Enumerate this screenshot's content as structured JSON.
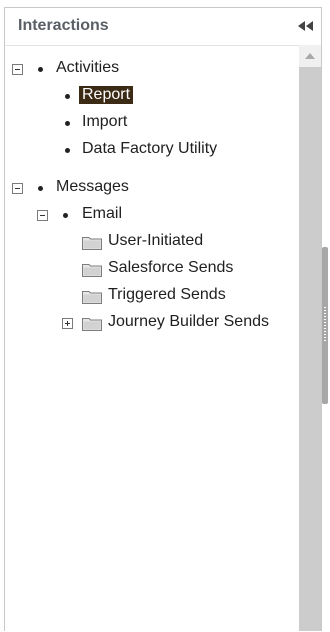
{
  "panel": {
    "title": "Interactions"
  },
  "tree": {
    "activities": {
      "label": "Activities",
      "items": [
        "Report",
        "Import",
        "Data Factory Utility"
      ]
    },
    "messages": {
      "label": "Messages",
      "email": {
        "label": "Email",
        "folders": [
          "User-Initiated",
          "Salesforce Sends",
          "Triggered Sends",
          "Journey Builder Sends"
        ]
      }
    },
    "selected": "Report"
  },
  "icons": {
    "collapse": "double-chevron-left-icon",
    "folder": "folder-icon",
    "expand": "plus-box-icon",
    "collapse_node": "minus-box-icon"
  },
  "colors": {
    "selected_bg": "#3b2a14",
    "selected_text": "#ffffff",
    "scrollbar": "#cccccc"
  }
}
